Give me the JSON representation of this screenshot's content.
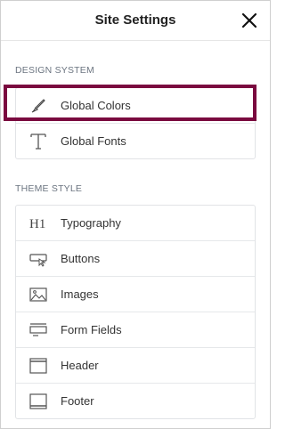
{
  "header": {
    "title": "Site Settings"
  },
  "design_system": {
    "title": "DESIGN SYSTEM",
    "items": [
      {
        "label": "Global Colors",
        "icon": "brush-icon"
      },
      {
        "label": "Global Fonts",
        "icon": "font-icon"
      }
    ]
  },
  "theme_style": {
    "title": "THEME STYLE",
    "items": [
      {
        "label": "Typography",
        "icon": "h1-icon"
      },
      {
        "label": "Buttons",
        "icon": "button-icon"
      },
      {
        "label": "Images",
        "icon": "image-icon"
      },
      {
        "label": "Form Fields",
        "icon": "form-fields-icon"
      },
      {
        "label": "Header",
        "icon": "header-icon"
      },
      {
        "label": "Footer",
        "icon": "footer-icon"
      }
    ]
  },
  "colors": {
    "highlight_border": "#7a0a3f"
  }
}
